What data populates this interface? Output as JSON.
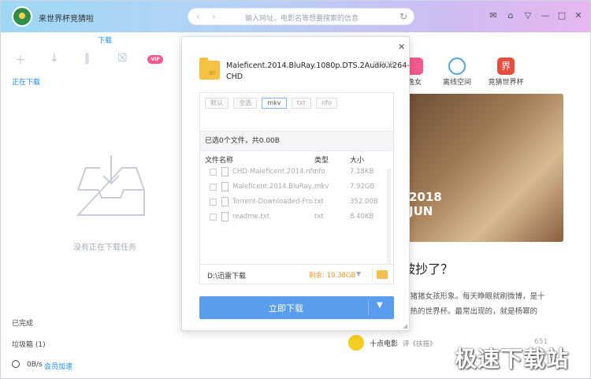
{
  "app": {
    "title": "来世界杯竞猜啦"
  },
  "search": {
    "placeholder": "输入网址、电影名等想要搜索的信息"
  },
  "sidebar": {
    "tab": "下载",
    "section_active": "正在下载",
    "vip": "VIP",
    "empty_text": "没有正在下载任务",
    "completed": "已完成",
    "trash": "垃圾箱 (1)",
    "speed": "0B/s",
    "speed_link": "会员加速"
  },
  "channels": [
    {
      "label": "逸女",
      "color": "#f25b8c"
    },
    {
      "label": "离线空间",
      "color": "#4aa3f0"
    },
    {
      "label": "竞猜世界杯",
      "color": "#e84d3d",
      "badge": "界"
    }
  ],
  "feed": {
    "poster_year": "2018",
    "poster_jun": "JUN",
    "headline": "被抄了？",
    "desc_line1": "的猪猪女孩形象。每天睁眼就刷微博，是十",
    "desc_line2": "火热的世界杯。最常出现的，就是杨幂的",
    "publisher": "十点电影",
    "tag": "评《扶摇》",
    "likes": "651"
  },
  "dialog": {
    "file_name": "Maleficent.2014.BluRay.1080p.DTS.2Audio.x264-CHD",
    "file_size": "0.00B",
    "file_icon_label": "BT",
    "filters": [
      {
        "label": "默认",
        "selected": false
      },
      {
        "label": "全选",
        "selected": false
      },
      {
        "label": "mkv",
        "selected": true
      },
      {
        "label": "txt",
        "selected": false
      },
      {
        "label": "nfo",
        "selected": false
      }
    ],
    "summary": "已选0个文件，共0.00B",
    "columns": {
      "name": "文件名称",
      "type": "类型",
      "size": "大小"
    },
    "files": [
      {
        "name": "CHD-Maleficent.2014.nfo",
        "type": "nfo",
        "size": "7.18KB"
      },
      {
        "name": "Maleficent.2014.BluRay...",
        "type": "mkv",
        "size": "7.92GB"
      },
      {
        "name": "Torrent-Downloaded-Fro...",
        "type": "txt",
        "size": "352.00B"
      },
      {
        "name": "readme.txt",
        "type": "txt",
        "size": "8.40KB"
      }
    ],
    "path": "D:\\迅雷下载",
    "free": "剩余: 19.38GB",
    "download_label": "立即下载"
  },
  "watermark": "极速下载站"
}
